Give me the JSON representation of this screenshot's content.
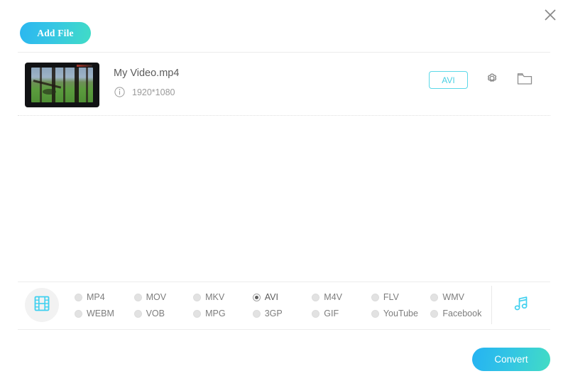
{
  "window": {
    "close_label": "×"
  },
  "toolbar": {
    "add_file_label": "Add File"
  },
  "file": {
    "name": "My Video.mp4",
    "resolution": "1920*1080",
    "output_format_badge": "AVI",
    "settings_icon": "gear-icon",
    "folder_icon": "folder-icon",
    "info_icon": "info-icon"
  },
  "format_panel": {
    "video_icon": "film-strip-icon",
    "audio_icon": "music-note-icon",
    "selected": "AVI",
    "options": [
      {
        "label": "MP4",
        "selected": false
      },
      {
        "label": "MOV",
        "selected": false
      },
      {
        "label": "MKV",
        "selected": false
      },
      {
        "label": "AVI",
        "selected": true
      },
      {
        "label": "M4V",
        "selected": false
      },
      {
        "label": "FLV",
        "selected": false
      },
      {
        "label": "WMV",
        "selected": false
      },
      {
        "label": "WEBM",
        "selected": false
      },
      {
        "label": "VOB",
        "selected": false
      },
      {
        "label": "MPG",
        "selected": false
      },
      {
        "label": "3GP",
        "selected": false
      },
      {
        "label": "GIF",
        "selected": false
      },
      {
        "label": "YouTube",
        "selected": false
      },
      {
        "label": "Facebook",
        "selected": false
      }
    ]
  },
  "actions": {
    "convert_label": "Convert"
  },
  "colors": {
    "accent_cyan": "#49cfe3",
    "gradient_start": "#25b3f2",
    "gradient_end": "#42dcc4",
    "text_primary": "#5b5b5b",
    "text_muted": "#9a9a9a"
  }
}
